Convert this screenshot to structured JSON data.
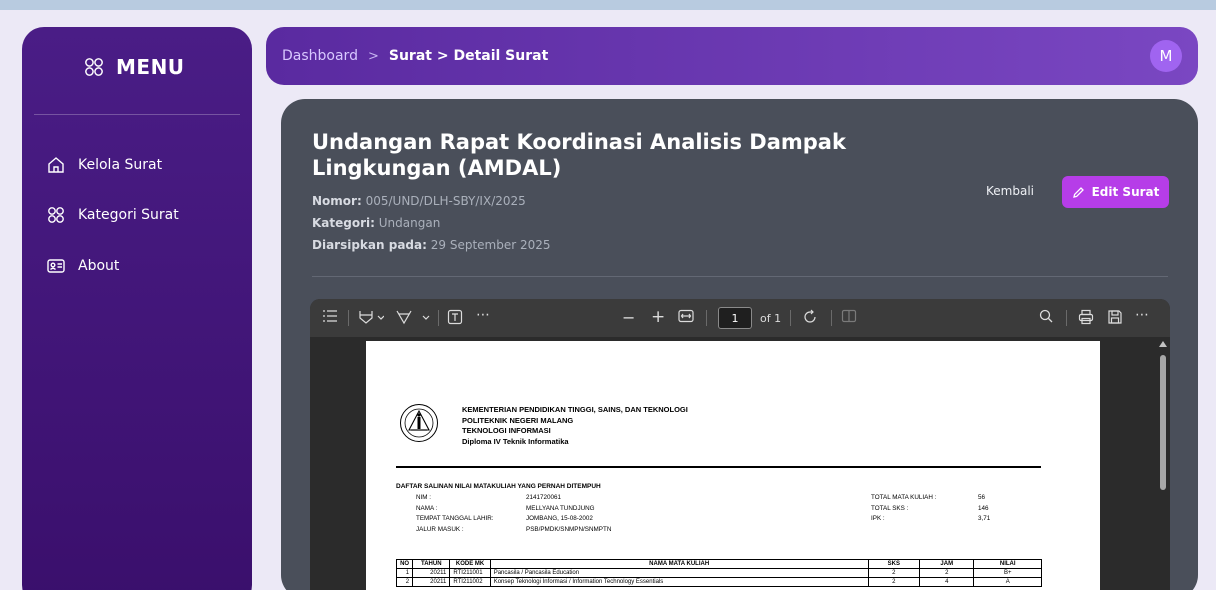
{
  "sidebar": {
    "title": "MENU",
    "items": [
      {
        "label": "Kelola Surat",
        "icon": "home-icon"
      },
      {
        "label": "Kategori Surat",
        "icon": "grid-icon"
      },
      {
        "label": "About",
        "icon": "id-card-icon"
      }
    ]
  },
  "header": {
    "breadcrumb_root": "Dashboard",
    "breadcrumb_sep": ">",
    "breadcrumb_current": "Surat > Detail Surat",
    "avatar_initial": "M"
  },
  "surat": {
    "title": "Undangan Rapat Koordinasi Analisis Dampak Lingkungan (AMDAL)",
    "nomor_label": "Nomor:",
    "nomor_value": "005/UND/DLH-SBY/IX/2025",
    "kategori_label": "Kategori:",
    "kategori_value": "Undangan",
    "arsip_label": "Diarsipkan pada:",
    "arsip_value": "29 September 2025",
    "back_label": "Kembali",
    "edit_label": "Edit Surat"
  },
  "viewer": {
    "page_current": "1",
    "page_total_label": "of 1"
  },
  "pdf": {
    "institution": [
      "KEMENTERIAN PENDIDIKAN TINGGI, SAINS, DAN TEKNOLOGI",
      "POLITEKNIK NEGERI MALANG",
      "TEKNOLOGI INFORMASI",
      "Diploma IV Teknik Informatika"
    ],
    "doc_title": "DAFTAR SALINAN NILAI MATAKULIAH YANG PERNAH DITEMPUH",
    "left_labels": [
      "NIM :",
      "NAMA :",
      "TEMPAT TANGGAL LAHIR:",
      "JALUR MASUK :"
    ],
    "left_values": [
      "2141720061",
      "MELLYANA TUNDJUNG",
      "JOMBANG, 15-08-2002",
      "PSB/PMDK/SNMPN/SNMPTN"
    ],
    "right_labels": [
      "TOTAL MATA KULIAH :",
      "TOTAL SKS :",
      "IPK :"
    ],
    "right_values": [
      "56",
      "146",
      "3,71"
    ],
    "table": {
      "headers": [
        "NO",
        "TAHUN",
        "KODE MK",
        "NAMA MATA KULIAH",
        "SKS",
        "JAM",
        "NILAI"
      ],
      "rows": [
        [
          "1",
          "20211",
          "RTI211001",
          "Pancasila / Pancasila Education",
          "2",
          "2",
          "B+"
        ],
        [
          "2",
          "20211",
          "RTI211002",
          "Konsep Teknologi Informasi / Information Technology Essentials",
          "2",
          "4",
          "A"
        ]
      ]
    }
  }
}
